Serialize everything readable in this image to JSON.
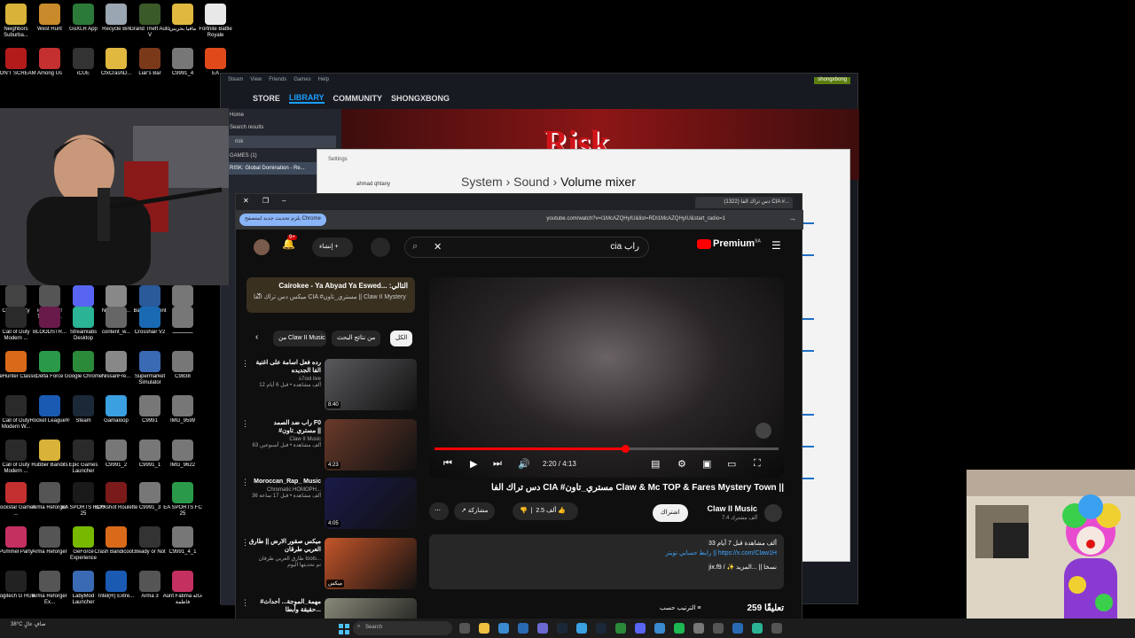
{
  "desktop": {
    "icons": [
      {
        "label": "Neighbors Suburba...",
        "color": "#d9b23a"
      },
      {
        "label": "West Hunt",
        "color": "#c98a2b"
      },
      {
        "label": "GoXLR App",
        "color": "#2b7a3a"
      },
      {
        "label": "Recycle Bin",
        "color": "#9aa6b2"
      },
      {
        "label": "Grand Theft Auto V",
        "color": "#3a5a2a"
      },
      {
        "label": "مافيا بحريني",
        "color": "#e0b840"
      },
      {
        "label": "Fortnite Battle Royale",
        "color": "#e8e8e8"
      },
      {
        "label": "DON'T SCREAM",
        "color": "#b31b1b"
      },
      {
        "label": "Among Us",
        "color": "#c43030"
      },
      {
        "label": "iCUE",
        "color": "#333333"
      },
      {
        "label": "CfxCrashD...",
        "color": "#e0b840"
      },
      {
        "label": "Liar's Bar",
        "color": "#7a3a1a"
      },
      {
        "label": "C9991_4",
        "color": "#777777"
      },
      {
        "label": "EA",
        "color": "#e04a1a"
      },
      {
        "label": "Call of Duty",
        "color": "#444444"
      },
      {
        "label": "Pushing it! Together...",
        "color": "#555555"
      },
      {
        "label": "Discord",
        "color": "#5865f2"
      },
      {
        "label": "NissanFre...",
        "color": "#888888"
      },
      {
        "label": "Badlion Client",
        "color": "#2a5a9a"
      },
      {
        "label": "ــــــــــــ",
        "color": "#777777"
      },
      {
        "label": "Call of Duty Modern ...",
        "color": "#2a2a2a"
      },
      {
        "label": "BLOODSTR...",
        "color": "#6a1a4a"
      },
      {
        "label": "Streamlabs Desktop",
        "color": "#2ab394"
      },
      {
        "label": "content_w...",
        "color": "#666666"
      },
      {
        "label": "Crosshair V2",
        "color": "#1a6ab3"
      },
      {
        "label": "ـــــــــــــ",
        "color": "#777777"
      },
      {
        "label": "theHunter Classic",
        "color": "#d96a1a"
      },
      {
        "label": "Delta Force",
        "color": "#2a9a4a"
      },
      {
        "label": "Google Chrome",
        "color": "#2a8a3a"
      },
      {
        "label": "NissanFre...",
        "color": "#888888"
      },
      {
        "label": "Supermarket Simulator",
        "color": "#3a6ab3"
      },
      {
        "label": "C9838",
        "color": "#777777"
      },
      {
        "label": "Call of Duty Modern W...",
        "color": "#2a2a2a"
      },
      {
        "label": "Rocket League®",
        "color": "#1a5ab3"
      },
      {
        "label": "Steam",
        "color": "#1b2838"
      },
      {
        "label": "Gamaloop",
        "color": "#3aa0e0"
      },
      {
        "label": "C9991",
        "color": "#777777"
      },
      {
        "label": "IMG_9599",
        "color": "#777777"
      },
      {
        "label": "Call of Duty Modern ...",
        "color": "#2a2a2a"
      },
      {
        "label": "Rubber Bandits",
        "color": "#d9b23a"
      },
      {
        "label": "Epic Games Launcher",
        "color": "#2a2a2a"
      },
      {
        "label": "C9991_2",
        "color": "#777777"
      },
      {
        "label": "C9991_1",
        "color": "#777777"
      },
      {
        "label": "IMG_9622",
        "color": "#777777"
      },
      {
        "label": "Rockstar Games ...",
        "color": "#c43030"
      },
      {
        "label": "Arma Reforger",
        "color": "#555555"
      },
      {
        "label": "EA SPORTS FC™ 25",
        "color": "#1a1a1a"
      },
      {
        "label": "Buckshot Roulette",
        "color": "#7a1a1a"
      },
      {
        "label": "C9991_3",
        "color": "#777777"
      },
      {
        "label": "EA SPORTS FC 25",
        "color": "#2a9a4a"
      },
      {
        "label": "Pummel Party",
        "color": "#c43060"
      },
      {
        "label": "Arma Reforger",
        "color": "#555555"
      },
      {
        "label": "GeForce Experience",
        "color": "#76b900"
      },
      {
        "label": "Crash Bandicoot...",
        "color": "#d96a1a"
      },
      {
        "label": "Ready or Not",
        "color": "#333333"
      },
      {
        "label": "C9991_4_1",
        "color": "#777777"
      },
      {
        "label": "Logitech G HUB",
        "color": "#222222"
      },
      {
        "label": "Arma Reforger Ex...",
        "color": "#555555"
      },
      {
        "label": "LabyMod Launcher",
        "color": "#3a6ab3"
      },
      {
        "label": "Intel(R) Extre...",
        "color": "#1a5ab3"
      },
      {
        "label": "Arma 3",
        "color": "#555555"
      },
      {
        "label": "Aunt Fatima خالة فاطمة",
        "color": "#c43060"
      }
    ]
  },
  "steam": {
    "menu": [
      "Steam",
      "View",
      "Friends",
      "Games",
      "Help"
    ],
    "nav": [
      "STORE",
      "LIBRARY",
      "COMMUNITY",
      "SHONGXBONG"
    ],
    "active_nav": "LIBRARY",
    "account": "shongxbong",
    "sidebar": [
      "Home",
      "Search results",
      "risk",
      "GAMES (1)",
      "RISK: Global Domination - Re..."
    ],
    "hero_text": "Risk"
  },
  "settings": {
    "app_title": "Settings",
    "user_name": "ahmad qhtany",
    "breadcrumb": [
      "System",
      "Sound",
      "Volume mixer"
    ]
  },
  "browser": {
    "tab_title": "(1322) دس تراك الفا CIA #...",
    "update_button": "يلزم تحديث جديد لمتصفح Chrome",
    "url": "youtube.com/watch?v=I1McAZQHyIU&list=RDI1McAZQHyIU&start_radio=1"
  },
  "youtube": {
    "logo": "Premium",
    "logo_region": "SA",
    "search_query": "cia راب",
    "create_label": "إنشاء",
    "notification_count": "9+",
    "player": {
      "current_time": "2:20",
      "duration": "4:13",
      "progress_fraction": 0.553
    },
    "video_title": "دس تراك الفا CIA #مستري_تاون Claw & Mc TOP & Fares Mystery Town ||",
    "channel_name": "Claw II Music",
    "channel_subs": "7.4 ألف مشترك",
    "subscribe_label": "اشتراك",
    "like_count": "2.5 ألف",
    "share_label": "مشاركة",
    "description": {
      "views": "33 ألف مشاهدة  قبل 7 أيام",
      "link_line": "رابط حسابي تويتر || https://x.com/Claw1H",
      "more_line": "jix.f9 / ✨ نسخا || ...المزيد"
    },
    "comments_count": "259 تعليقًا",
    "sort_label": "الترتيب حسب",
    "playlist": {
      "title": "Cairokee - Ya Abyad Ya Eswed... :التالي",
      "subtitle": "ميكس دس تراك الفا CIA #مستري_تاون || Claw II Mystery Town"
    },
    "chips": [
      "الكل",
      "من نتائج البحث",
      "من Claw II Music"
    ],
    "active_chip": "الكل",
    "recommendations": [
      {
        "title": "رده فعل اسامة على اغنية الفا الجديده",
        "channel": "s7ool live",
        "meta": "12 ألف مشاهدة • قبل 6 أيام",
        "duration": "8:40",
        "color": "#5a5a5e"
      },
      {
        "title": "راب ضد الصمد F0 #مستري_تاون ||",
        "channel": "Claw II Music",
        "meta": "63 ألف مشاهدة • قبل أسبوعين",
        "duration": "4:23",
        "color": "#6a3a2a"
      },
      {
        "title": "Moroccan_Rap_ Music",
        "channel": "Chromatic HOMOPH...",
        "meta": "36 ألف مشاهدة • قبل 17 ساعة",
        "duration": "4:05",
        "color": "#1a1a4a"
      },
      {
        "title": "ميكس صقور الارض || طارق العربي طرقان",
        "channel": "طارق العربي طرقان tools...",
        "meta": "تم تحديثها اليوم",
        "duration": "ميكس",
        "color": "#c4552a"
      },
      {
        "title": "#مهمة_الموجة... أحداث حقيقة وأبطا...",
        "channel": "",
        "meta": "",
        "duration": "",
        "color": "#8a8a7a"
      }
    ]
  },
  "taskbar": {
    "weather": "38°C صافٍ عالٍ",
    "search_placeholder": "Search"
  }
}
